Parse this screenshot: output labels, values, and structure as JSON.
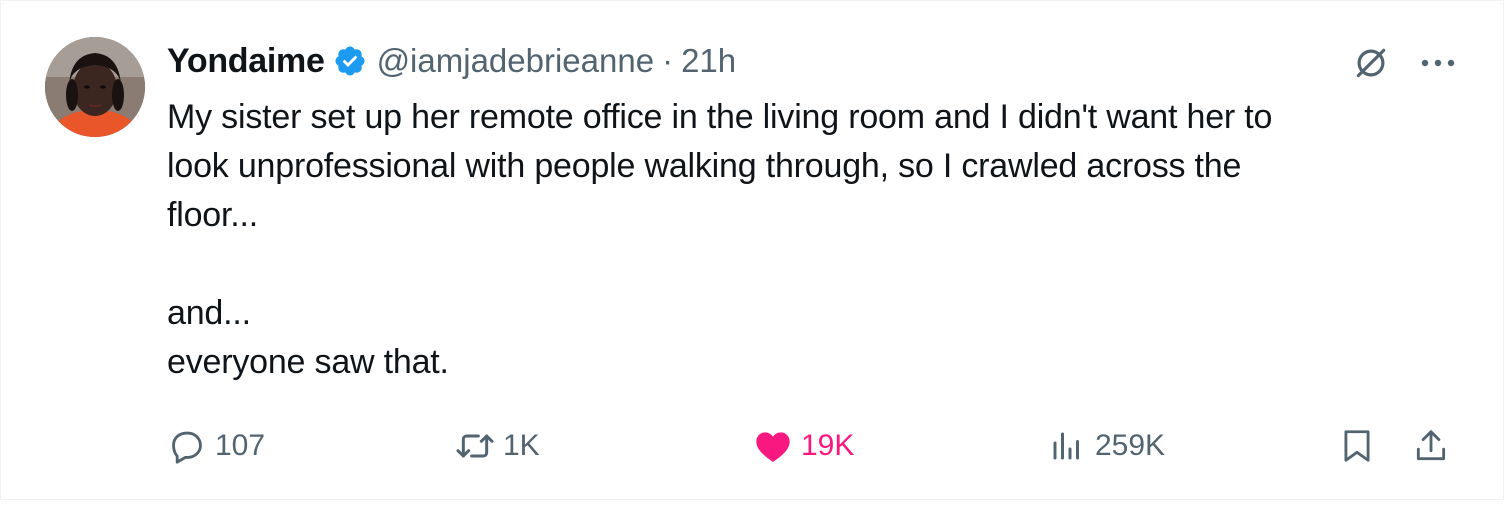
{
  "tweet": {
    "author": {
      "display_name": "Yondaime",
      "handle": "@iamjadebrieanne",
      "verified": true
    },
    "separator": "·",
    "time": "21h",
    "text_lines": [
      "My sister set up her remote office in the living room and I didn't want her to",
      "look unprofessional with people walking through, so I crawled across the",
      "floor...",
      "",
      "and...",
      "everyone saw that."
    ],
    "stats": {
      "replies": "107",
      "retweets": "1K",
      "likes": "19K",
      "views": "259K"
    }
  },
  "icons": {
    "avatar": "avatar",
    "verified": "verified-badge-icon",
    "grok": "grok-icon",
    "more": "more-icon",
    "reply": "reply-icon",
    "retweet": "retweet-icon",
    "like": "heart-icon",
    "views": "views-icon",
    "bookmark": "bookmark-icon",
    "share": "share-icon"
  },
  "colors": {
    "text": "#0f1419",
    "secondary": "#536471",
    "verified": "#1d9bf0",
    "like": "#f91880",
    "border": "#eff3f4"
  }
}
